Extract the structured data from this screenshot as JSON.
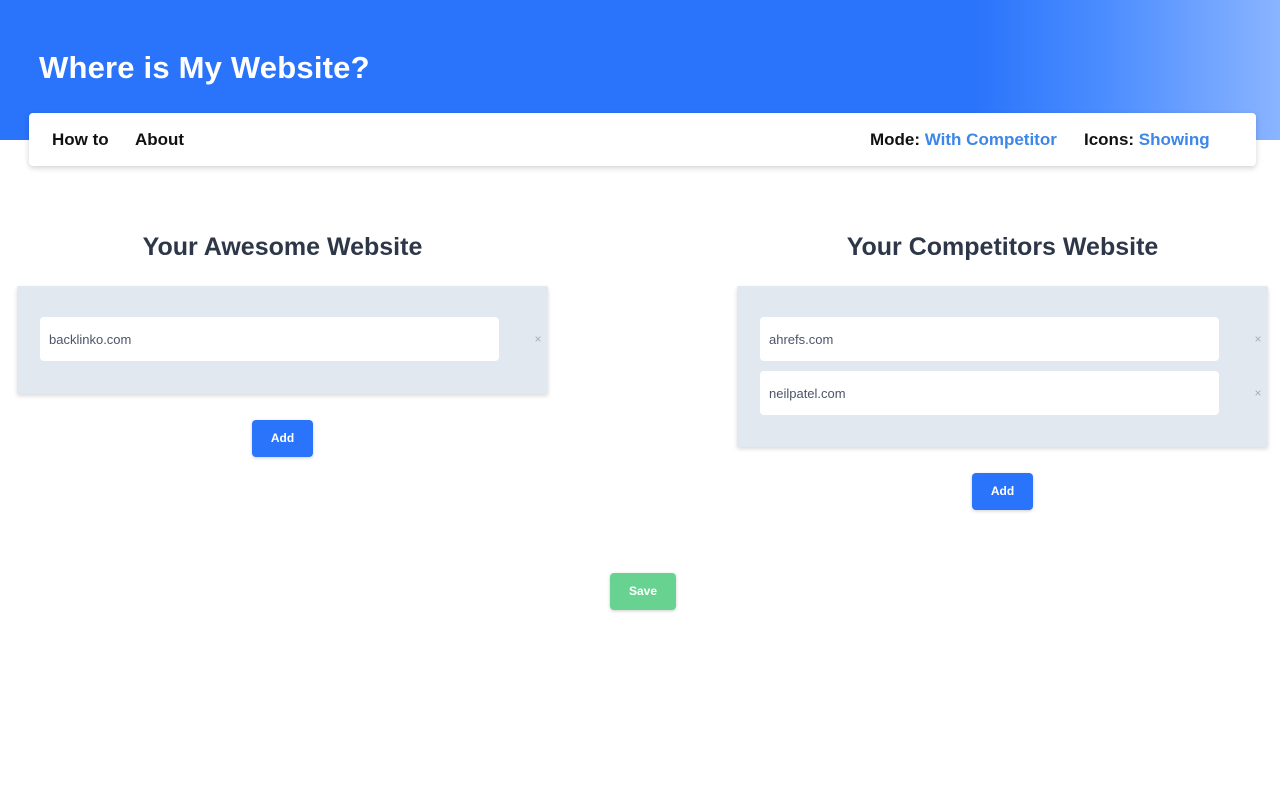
{
  "header": {
    "title": "Where is My Website?"
  },
  "nav": {
    "links": [
      {
        "label": "How to"
      },
      {
        "label": "About"
      }
    ],
    "mode": {
      "label": "Mode:",
      "value": "With Competitor"
    },
    "icons": {
      "label": "Icons:",
      "value": "Showing"
    }
  },
  "your_site": {
    "title": "Your Awesome Website",
    "sites": [
      "backlinko.com"
    ],
    "add_label": "Add"
  },
  "competitors": {
    "title": "Your Competitors Website",
    "sites": [
      "ahrefs.com",
      "neilpatel.com"
    ],
    "add_label": "Add"
  },
  "remove_glyph": "×",
  "save_label": "Save",
  "colors": {
    "primary": "#2a74fb",
    "accent_text": "#3d86ea",
    "save": "#68d391",
    "panel_bg": "#e2e8f0",
    "heading": "#2d3748"
  }
}
